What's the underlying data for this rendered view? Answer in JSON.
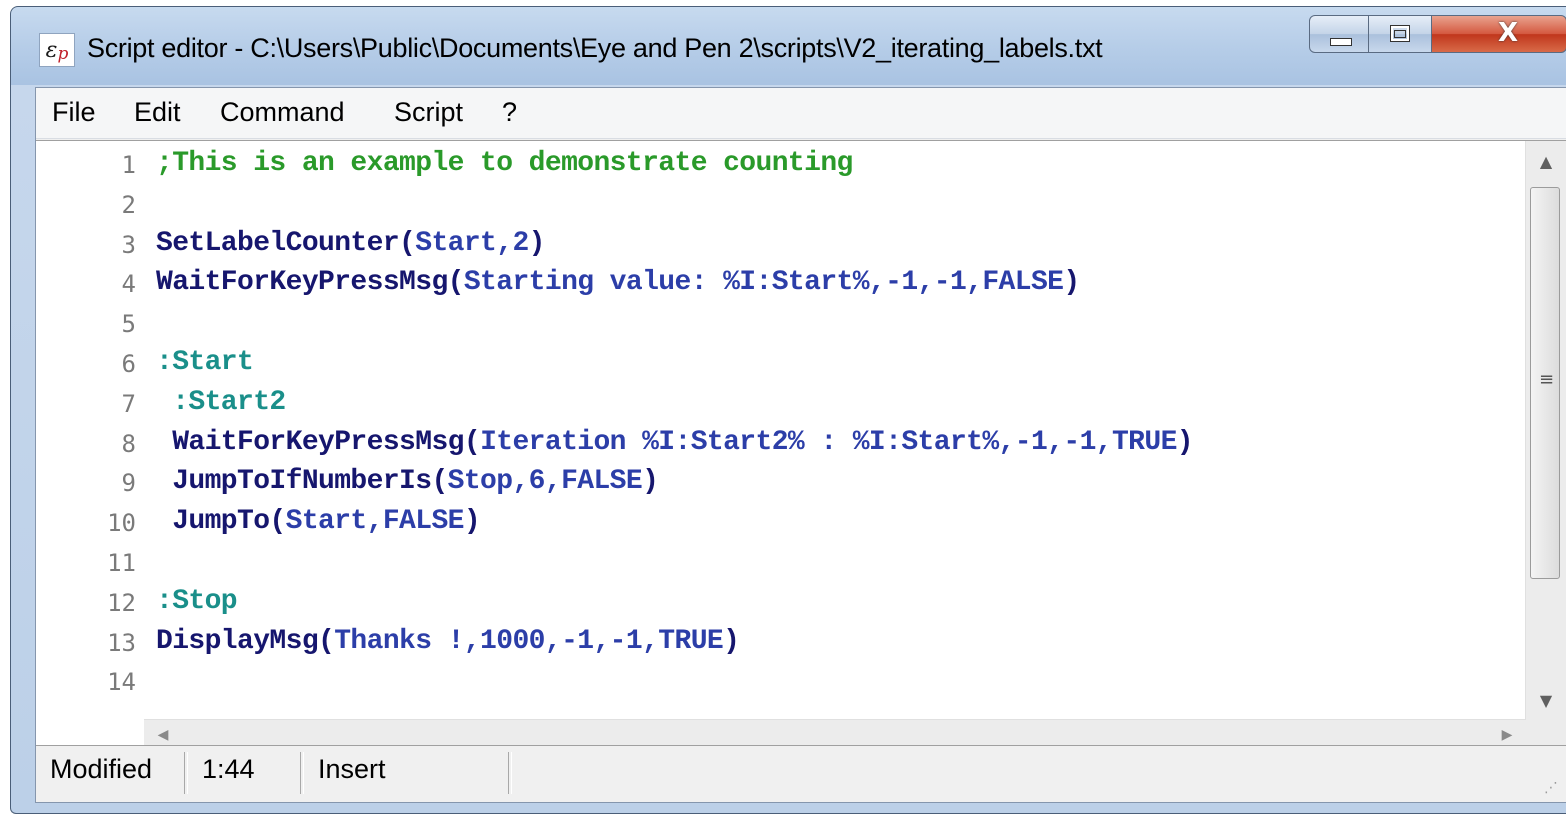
{
  "window": {
    "title": "Script editor - C:\\Users\\Public\\Documents\\Eye and Pen 2\\scripts\\V2_iterating_labels.txt",
    "icon": "eye-and-pen-icon",
    "controls": [
      "minimize-icon",
      "maximize-icon",
      "close-icon"
    ]
  },
  "menu": [
    "File",
    "Edit",
    "Command",
    "Script",
    "?"
  ],
  "editor": {
    "lines": [
      {
        "num": "1",
        "text": ";This is an example to demonstrate counting"
      },
      {
        "num": "2",
        "text": ""
      },
      {
        "num": "3",
        "text": "SetLabelCounter(Start,2)"
      },
      {
        "num": "4",
        "text": "WaitForKeyPressMsg(Starting value: %I:Start%,-1,-1,FALSE)"
      },
      {
        "num": "5",
        "text": ""
      },
      {
        "num": "6",
        "text": ":Start"
      },
      {
        "num": "7",
        "text": " :Start2"
      },
      {
        "num": "8",
        "text": " WaitForKeyPressMsg(Iteration %I:Start2% : %I:Start%,-1,-1,TRUE)"
      },
      {
        "num": "9",
        "text": " JumpToIfNumberIs(Stop,6,FALSE)"
      },
      {
        "num": "10",
        "text": " JumpTo(Start,FALSE)"
      },
      {
        "num": "11",
        "text": ""
      },
      {
        "num": "12",
        "text": ":Stop"
      },
      {
        "num": "13",
        "text": "DisplayMsg(Thanks !,1000,-1,-1,TRUE)"
      },
      {
        "num": "14",
        "text": ""
      }
    ]
  },
  "statusbar": {
    "state": "Modified",
    "position": "1:44",
    "mode": "Insert"
  },
  "colors": {
    "comment": "#2a9a2a",
    "function": "#16166e",
    "argument": "#2c3ea8",
    "label": "#1a8f8a"
  }
}
